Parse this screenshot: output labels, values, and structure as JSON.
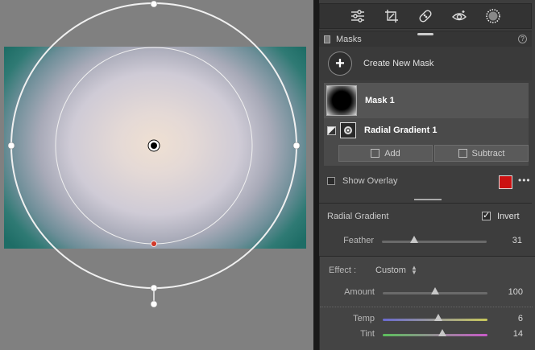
{
  "toolbar": {
    "tools": [
      {
        "name": "edit-sliders-icon"
      },
      {
        "name": "crop-icon"
      },
      {
        "name": "healing-bandage-icon"
      },
      {
        "name": "red-eye-icon"
      },
      {
        "name": "masking-icon"
      }
    ]
  },
  "masks_panel": {
    "title": "Masks",
    "help_label": "?",
    "create_label": "Create New Mask",
    "create_symbol": "+",
    "mask": {
      "name": "Mask 1"
    },
    "component": {
      "name": "Radial Gradient 1"
    },
    "add_label": "Add",
    "subtract_label": "Subtract",
    "show_overlay_label": "Show Overlay",
    "overlay_color": "#cc1111",
    "more_label": "•••"
  },
  "radial_gradient": {
    "title": "Radial Gradient",
    "invert_label": "Invert",
    "invert_checked": true,
    "invert_mark": "✓",
    "feather": {
      "label": "Feather",
      "value": "31",
      "fraction": 0.31
    }
  },
  "effect": {
    "label": "Effect :",
    "preset": "Custom",
    "amount": {
      "label": "Amount",
      "value": "100",
      "fraction": 0.5
    },
    "temp": {
      "label": "Temp",
      "value": "6",
      "fraction": 0.53
    },
    "tint": {
      "label": "Tint",
      "value": "14",
      "fraction": 0.57
    }
  },
  "colors": {
    "panel_bg": "#3d3d3d",
    "accent_red": "#cc1111",
    "temp_track": "#6a6ad0",
    "tint_track": "#5cc05c"
  }
}
